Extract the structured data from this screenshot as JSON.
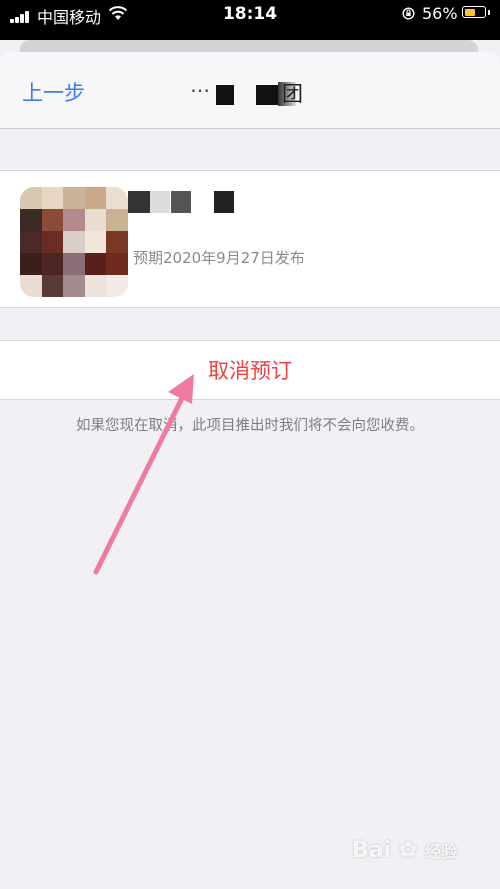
{
  "status_bar": {
    "carrier": "中国移动",
    "time": "18:14",
    "battery_percent": "56%",
    "battery_level": 0.56,
    "icons": [
      "signal-icon",
      "wifi-icon",
      "rotation-lock-icon",
      "battery-icon"
    ]
  },
  "nav": {
    "back_label": "上一步",
    "title_visible_fragment": "团"
  },
  "item": {
    "subtitle": "预期2020年9月27日发布"
  },
  "actions": {
    "cancel_label": "取消预订"
  },
  "note": "如果您现在取消，此项目推出时我们将不会向您收费。",
  "colors": {
    "link_blue": "#3a7cf5",
    "destructive_red": "#f04040",
    "annotation_pink": "#f07aa0",
    "battery_yellow": "#f5c62f"
  },
  "watermark": {
    "text": "Bai",
    "suffix": "经验"
  }
}
